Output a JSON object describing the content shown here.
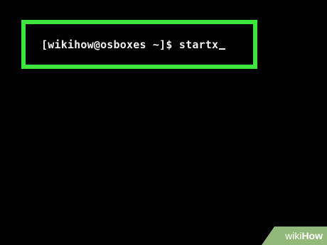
{
  "terminal": {
    "prompt": "[wikihow@osboxes ~]$ ",
    "command": "startx"
  },
  "watermark": {
    "part1": "wiki",
    "part2": "How"
  },
  "colors": {
    "background": "#000000",
    "highlight": "#3fe53f",
    "text": "#f2f2f2",
    "watermark_bg": "#93b97a"
  }
}
